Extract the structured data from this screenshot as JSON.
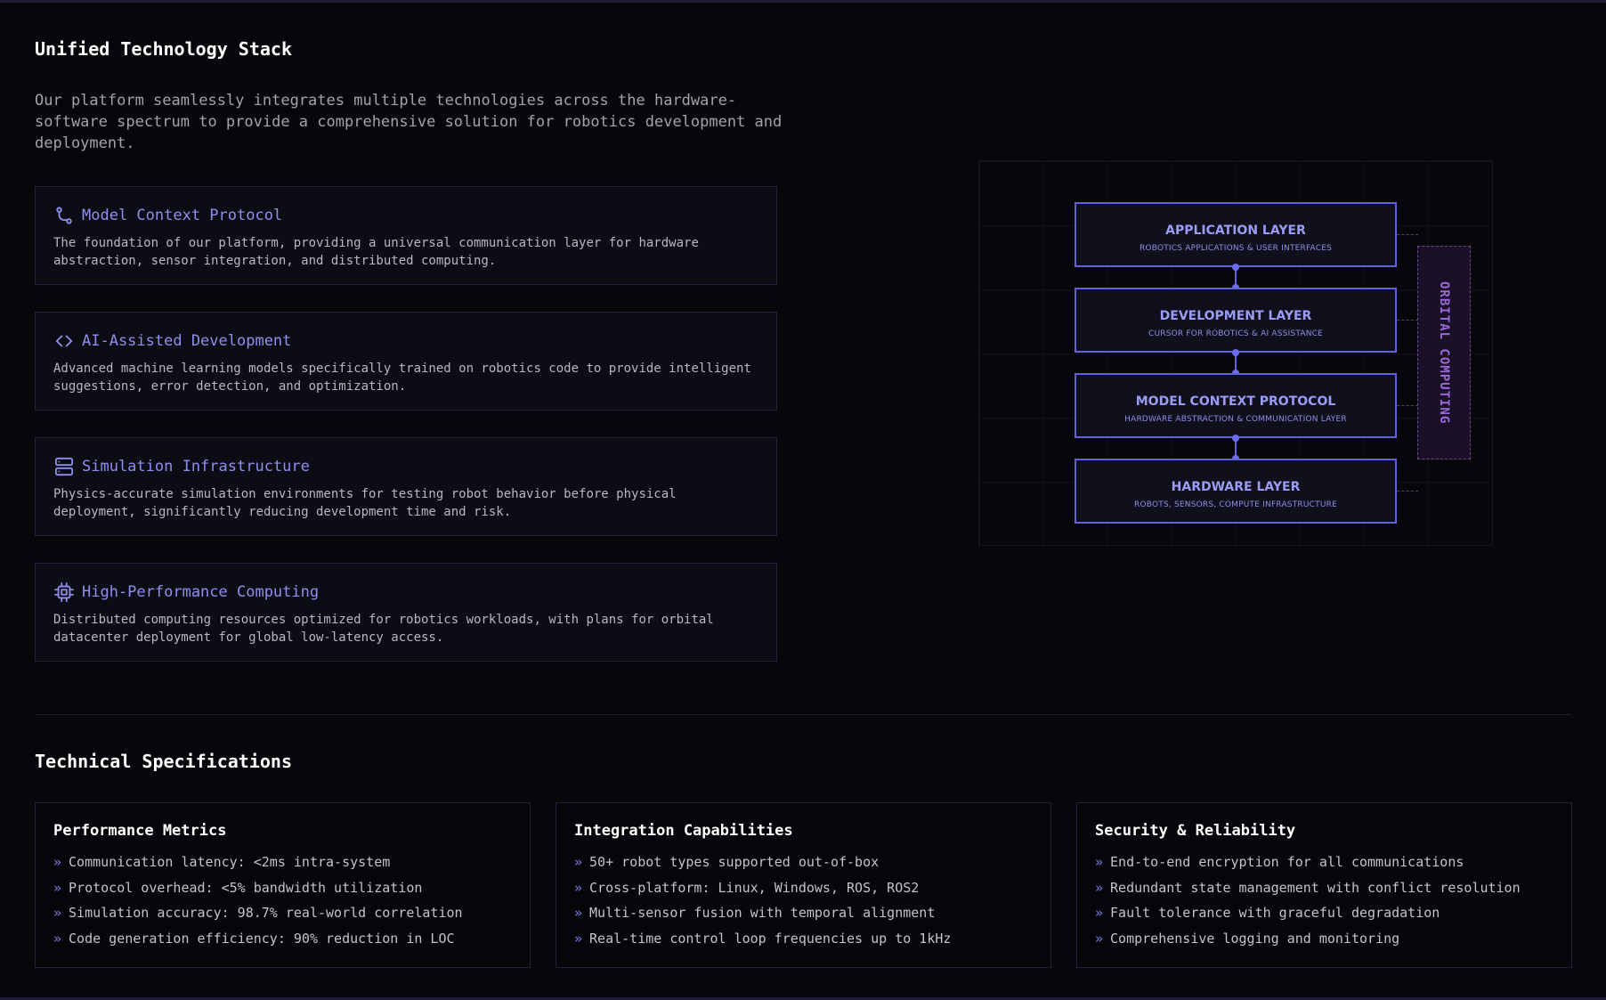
{
  "stack": {
    "title": "Unified Technology Stack",
    "intro": "Our platform seamlessly integrates multiple technologies across the hardware-software spectrum to provide a comprehensive solution for robotics development and deployment.",
    "features": [
      {
        "icon": "git-branch-icon",
        "title": "Model Context Protocol",
        "description": "The foundation of our platform, providing a universal communication layer for hardware abstraction, sensor integration, and distributed computing."
      },
      {
        "icon": "code-icon",
        "title": "AI-Assisted Development",
        "description": "Advanced machine learning models specifically trained on robotics code to provide intelligent suggestions, error detection, and optimization."
      },
      {
        "icon": "server-icon",
        "title": "Simulation Infrastructure",
        "description": "Physics-accurate simulation environments for testing robot behavior before physical deployment, significantly reducing development time and risk."
      },
      {
        "icon": "cpu-icon",
        "title": "High-Performance Computing",
        "description": "Distributed computing resources optimized for robotics workloads, with plans for orbital datacenter deployment for global low-latency access."
      }
    ]
  },
  "diagram": {
    "layers": [
      {
        "title": "APPLICATION LAYER",
        "subtitle": "ROBOTICS APPLICATIONS & USER INTERFACES"
      },
      {
        "title": "DEVELOPMENT LAYER",
        "subtitle": "CURSOR FOR ROBOTICS & AI ASSISTANCE"
      },
      {
        "title": "MODEL CONTEXT PROTOCOL",
        "subtitle": "HARDWARE ABSTRACTION & COMMUNICATION LAYER"
      },
      {
        "title": "HARDWARE LAYER",
        "subtitle": "ROBOTS, SENSORS, COMPUTE INFRASTRUCTURE"
      }
    ],
    "side_label": "ORBITAL COMPUTING"
  },
  "specs": {
    "title": "Technical Specifications",
    "bullet": "»",
    "cards": [
      {
        "title": "Performance Metrics",
        "items": [
          "Communication latency: <2ms intra-system",
          "Protocol overhead: <5% bandwidth utilization",
          "Simulation accuracy: 98.7% real-world correlation",
          "Code generation efficiency: 90% reduction in LOC"
        ]
      },
      {
        "title": "Integration Capabilities",
        "items": [
          "50+ robot types supported out-of-box",
          "Cross-platform: Linux, Windows, ROS, ROS2",
          "Multi-sensor fusion with temporal alignment",
          "Real-time control loop frequencies up to 1kHz"
        ]
      },
      {
        "title": "Security & Reliability",
        "items": [
          "End-to-end encryption for all communications",
          "Redundant state management with conflict resolution",
          "Fault tolerance with graceful degradation",
          "Comprehensive logging and monitoring"
        ]
      }
    ]
  },
  "colors": {
    "background": "#07070b",
    "accent": "#8f8ff2",
    "layer_border": "#6262dc",
    "orbital": "#9a6ad8"
  }
}
